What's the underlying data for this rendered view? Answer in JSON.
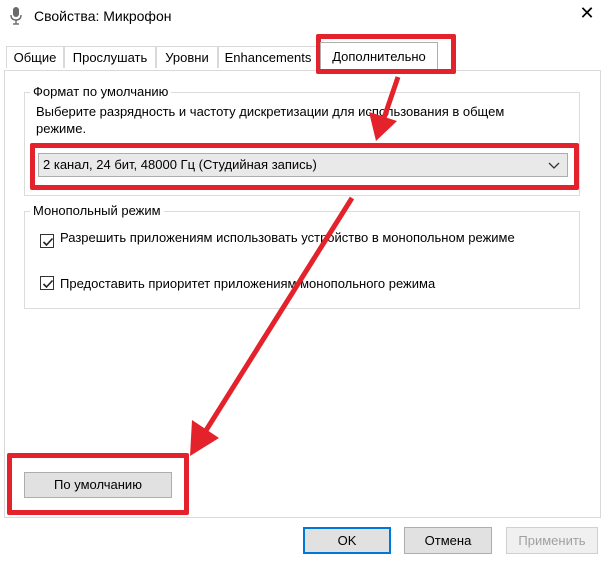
{
  "window": {
    "title": "Свойства: Микрофон",
    "close_glyph": "✕"
  },
  "tabs": [
    {
      "label": "Общие"
    },
    {
      "label": "Прослушать"
    },
    {
      "label": "Уровни"
    },
    {
      "label": "Enhancements"
    },
    {
      "label": "Дополнительно",
      "active": true
    }
  ],
  "default_format": {
    "legend": "Формат по умолчанию",
    "description": "Выберите разрядность и частоту дискретизации для использования в общем режиме.",
    "selected": "2 канал, 24 бит, 48000 Гц (Студийная запись)"
  },
  "exclusive_mode": {
    "legend": "Монопольный режим",
    "options": [
      {
        "label": "Разрешить приложениям использовать устройство в монопольном режиме",
        "checked": true
      },
      {
        "label": "Предоставить приоритет приложениям монопольного режима",
        "checked": true
      }
    ]
  },
  "restore_button": "По умолчанию",
  "footer": {
    "ok": "OK",
    "cancel": "Отмена",
    "apply": "Применить"
  },
  "colors": {
    "highlight": "#e3222b",
    "focus_border": "#0078d7"
  }
}
